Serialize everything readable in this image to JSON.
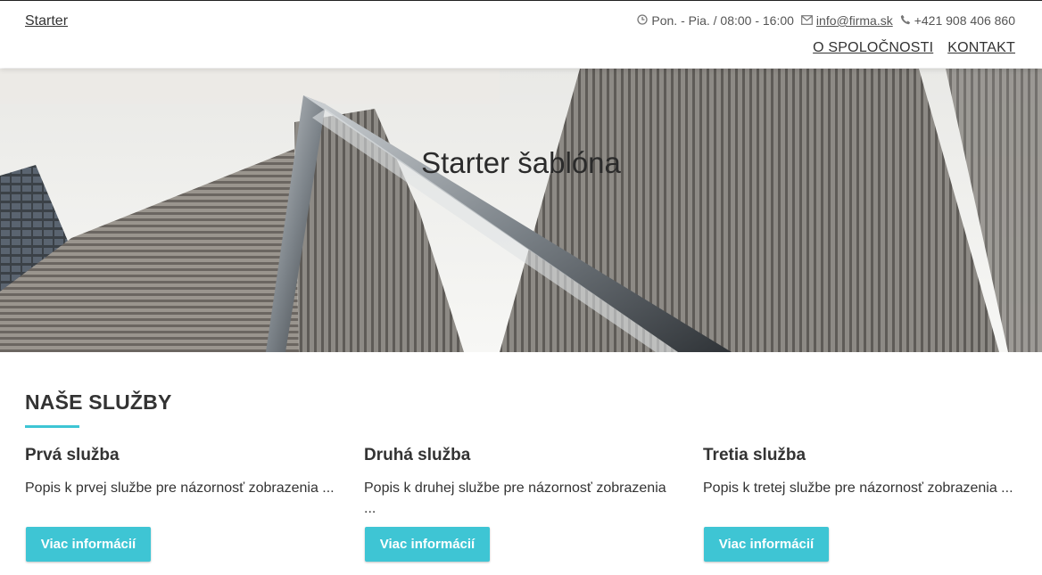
{
  "brand": "Starter",
  "contact": {
    "hours": "Pon. - Pia. / 08:00 - 16:00",
    "email": "info@firma.sk",
    "phone": "+421 908 406 860"
  },
  "nav": {
    "about": "O SPOLOČNOSTI",
    "contact": "KONTAKT"
  },
  "hero": {
    "title": "Starter šablóna"
  },
  "services": {
    "heading": "NAŠE SLUŽBY",
    "items": [
      {
        "title": "Prvá služba",
        "text": "Popis k prvej službe pre názornosť zobrazenia ...",
        "button": "Viac informácií"
      },
      {
        "title": "Druhá služba",
        "text": "Popis k druhej službe pre názornosť zobrazenia ...",
        "button": "Viac informácií"
      },
      {
        "title": "Tretia služba",
        "text": "Popis k tretej službe pre názornosť zobrazenia ...",
        "button": "Viac informácií"
      }
    ]
  },
  "colors": {
    "accent": "#3ec5d4",
    "text": "#333333"
  }
}
